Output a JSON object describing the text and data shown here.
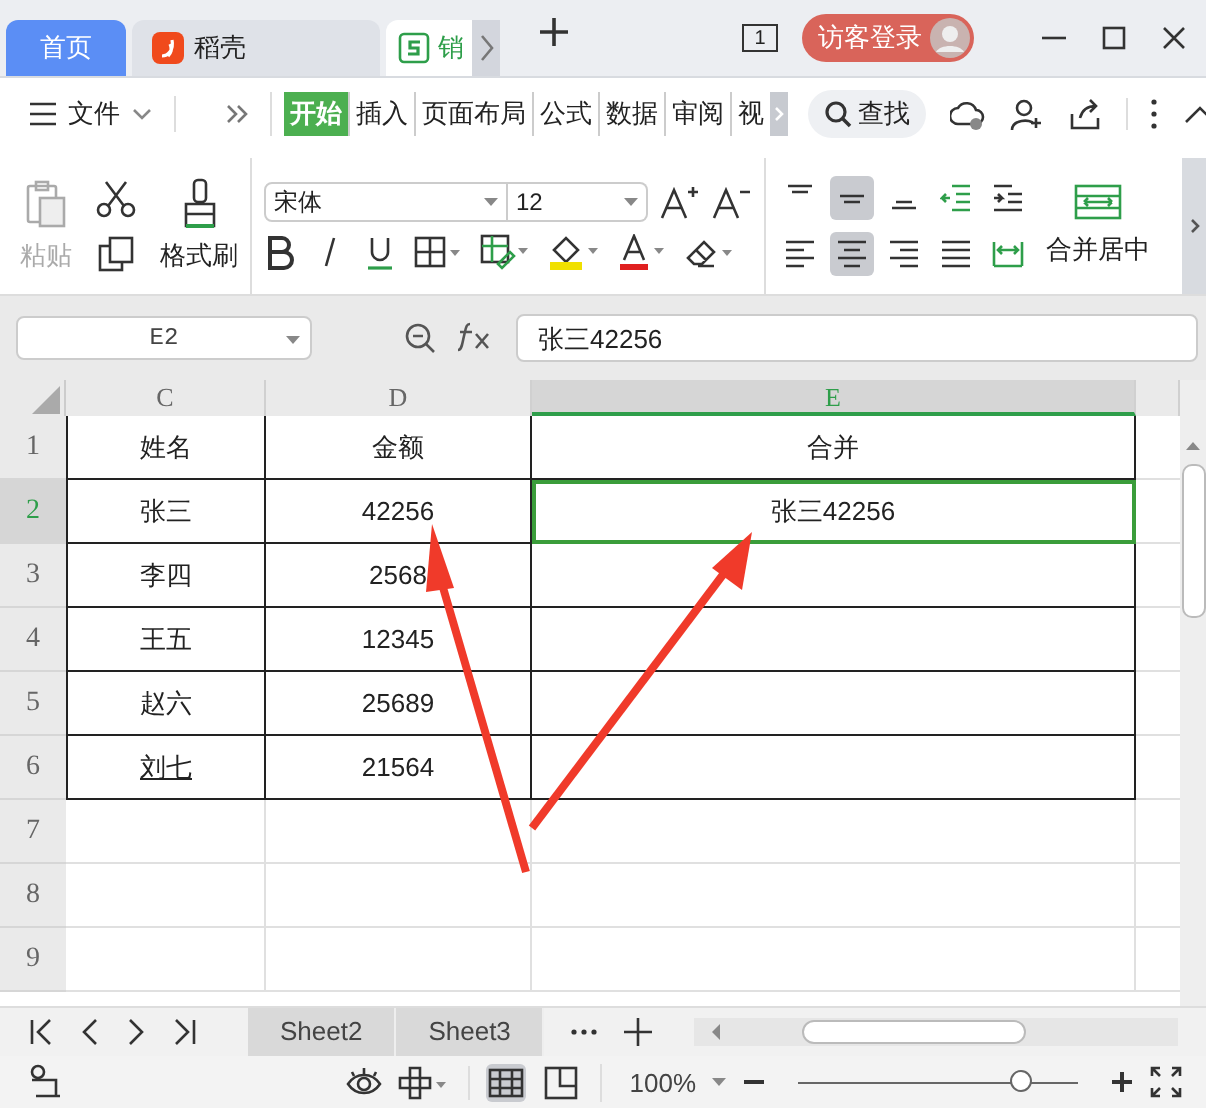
{
  "title_tabs": [
    {
      "label": "首页",
      "kind": "home",
      "selected": false
    },
    {
      "label": "稻壳",
      "kind": "docer",
      "selected": false
    },
    {
      "label": "销",
      "kind": "sheet",
      "selected": true
    }
  ],
  "account": {
    "label": "访客登录",
    "page_count": "1"
  },
  "menu": {
    "file": "文件",
    "tabs": [
      {
        "label": "开始",
        "selected": true
      },
      {
        "label": "插入",
        "selected": false
      },
      {
        "label": "页面布局",
        "selected": false
      },
      {
        "label": "公式",
        "selected": false
      },
      {
        "label": "数据",
        "selected": false
      },
      {
        "label": "审阅",
        "selected": false
      },
      {
        "label": "视",
        "selected": false
      }
    ],
    "search": "查找"
  },
  "ribbon": {
    "paste": "粘贴",
    "format_painter": "格式刷",
    "font": "宋体",
    "font_size": "12",
    "merge": "合并居中"
  },
  "formula_bar": {
    "cell": "E2",
    "formula": "张三42256"
  },
  "sheet": {
    "columns": [
      {
        "label": "C",
        "selected": false
      },
      {
        "label": "D",
        "selected": false
      },
      {
        "label": "E",
        "selected": true
      }
    ],
    "rows": [
      {
        "label": "1",
        "selected": false,
        "cells": [
          {
            "text": "姓名",
            "underline": false
          },
          {
            "text": "金额",
            "underline": false
          },
          {
            "text": "合并",
            "underline": false
          }
        ]
      },
      {
        "label": "2",
        "selected": true,
        "cells": [
          {
            "text": "张三",
            "underline": false
          },
          {
            "text": "42256",
            "underline": false
          },
          {
            "text": "张三42256",
            "underline": false
          }
        ]
      },
      {
        "label": "3",
        "selected": false,
        "cells": [
          {
            "text": "李四",
            "underline": false
          },
          {
            "text": "2568",
            "underline": false
          }
        ]
      },
      {
        "label": "4",
        "selected": false,
        "cells": [
          {
            "text": "王五",
            "underline": false
          },
          {
            "text": "12345",
            "underline": false
          }
        ]
      },
      {
        "label": "5",
        "selected": false,
        "cells": [
          {
            "text": "赵六",
            "underline": false
          },
          {
            "text": "25689",
            "underline": false
          }
        ]
      },
      {
        "label": "6",
        "selected": false,
        "cells": [
          {
            "text": "刘七",
            "underline": true
          },
          {
            "text": "21564",
            "underline": false
          }
        ]
      },
      {
        "label": "7",
        "selected": false
      },
      {
        "label": "8",
        "selected": false
      },
      {
        "label": "9",
        "selected": false
      }
    ]
  },
  "sheet_tabs": [
    {
      "label": "Sheet2",
      "selected": false
    },
    {
      "label": "Sheet3",
      "selected": false
    }
  ],
  "status_bar": {
    "zoom": "100%",
    "level": 0.8
  }
}
